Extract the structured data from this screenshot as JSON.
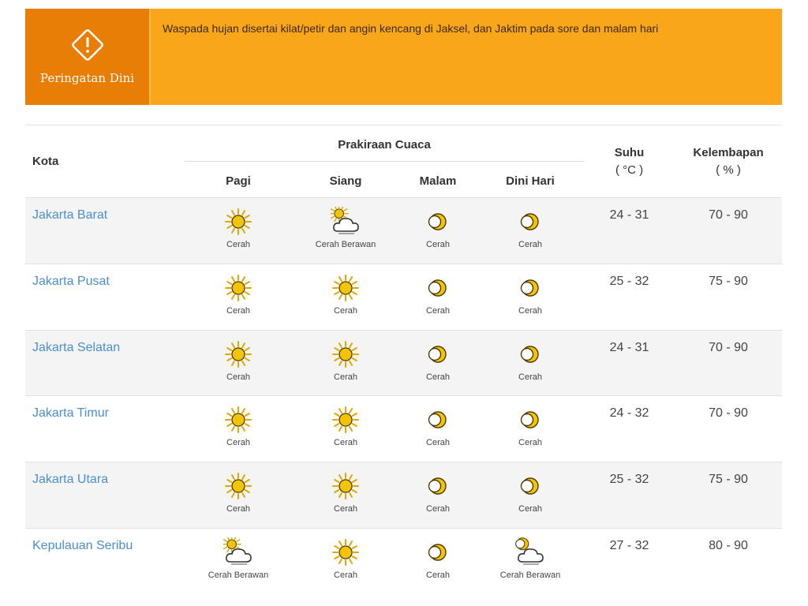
{
  "alert": {
    "title": "Peringatan Dini",
    "message": "Waspada  hujan disertai kilat/petir dan angin kencang di Jaksel, dan Jaktim pada sore dan malam hari"
  },
  "table": {
    "col_city": "Kota",
    "col_forecast": "Prakiraan Cuaca",
    "periods": [
      "Pagi",
      "Siang",
      "Malam",
      "Dini Hari"
    ],
    "col_temp": "Suhu",
    "col_temp_unit": "( °C )",
    "col_humidity": "Kelembapan",
    "col_humidity_unit": "( % )",
    "rows": [
      {
        "city": "Jakarta Barat",
        "forecast": [
          {
            "icon": "sun-icon",
            "label": "Cerah"
          },
          {
            "icon": "sun-cloud-icon",
            "label": "Cerah Berawan"
          },
          {
            "icon": "moon-icon",
            "label": "Cerah"
          },
          {
            "icon": "moon-icon",
            "label": "Cerah"
          }
        ],
        "temp": "24 - 31",
        "humidity": "70 - 90"
      },
      {
        "city": "Jakarta Pusat",
        "forecast": [
          {
            "icon": "sun-icon",
            "label": "Cerah"
          },
          {
            "icon": "sun-icon",
            "label": "Cerah"
          },
          {
            "icon": "moon-icon",
            "label": "Cerah"
          },
          {
            "icon": "moon-icon",
            "label": "Cerah"
          }
        ],
        "temp": "25 - 32",
        "humidity": "75 - 90"
      },
      {
        "city": "Jakarta Selatan",
        "forecast": [
          {
            "icon": "sun-icon",
            "label": "Cerah"
          },
          {
            "icon": "sun-icon",
            "label": "Cerah"
          },
          {
            "icon": "moon-icon",
            "label": "Cerah"
          },
          {
            "icon": "moon-icon",
            "label": "Cerah"
          }
        ],
        "temp": "24 - 31",
        "humidity": "70 - 90"
      },
      {
        "city": "Jakarta Timur",
        "forecast": [
          {
            "icon": "sun-icon",
            "label": "Cerah"
          },
          {
            "icon": "sun-icon",
            "label": "Cerah"
          },
          {
            "icon": "moon-icon",
            "label": "Cerah"
          },
          {
            "icon": "moon-icon",
            "label": "Cerah"
          }
        ],
        "temp": "24 - 32",
        "humidity": "70 - 90"
      },
      {
        "city": "Jakarta Utara",
        "forecast": [
          {
            "icon": "sun-icon",
            "label": "Cerah"
          },
          {
            "icon": "sun-icon",
            "label": "Cerah"
          },
          {
            "icon": "moon-icon",
            "label": "Cerah"
          },
          {
            "icon": "moon-icon",
            "label": "Cerah"
          }
        ],
        "temp": "25 - 32",
        "humidity": "75 - 90"
      },
      {
        "city": "Kepulauan Seribu",
        "forecast": [
          {
            "icon": "sun-cloud-icon",
            "label": "Cerah Berawan"
          },
          {
            "icon": "sun-icon",
            "label": "Cerah"
          },
          {
            "icon": "moon-icon",
            "label": "Cerah"
          },
          {
            "icon": "moon-cloud-icon",
            "label": "Cerah Berawan"
          }
        ],
        "temp": "27 - 32",
        "humidity": "80 - 90"
      }
    ]
  },
  "colors": {
    "alert_bg": "#faa61a",
    "alert_icon_bg": "#e87e05",
    "city_link": "#4a8fcf",
    "sun": "#f5c400"
  }
}
